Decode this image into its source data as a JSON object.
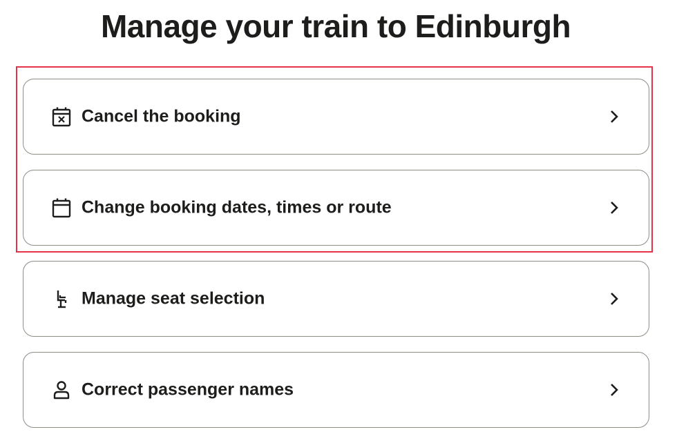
{
  "page": {
    "title": "Manage your train to Edinburgh"
  },
  "options": [
    {
      "label": "Cancel the booking",
      "icon": "calendar-cancel-icon"
    },
    {
      "label": "Change booking dates, times or route",
      "icon": "calendar-icon"
    },
    {
      "label": "Manage seat selection",
      "icon": "seat-icon"
    },
    {
      "label": "Correct passenger names",
      "icon": "person-icon"
    }
  ],
  "colors": {
    "text": "#1d1d1b",
    "card_border": "#8f8c83",
    "highlight": "#e5324b"
  }
}
